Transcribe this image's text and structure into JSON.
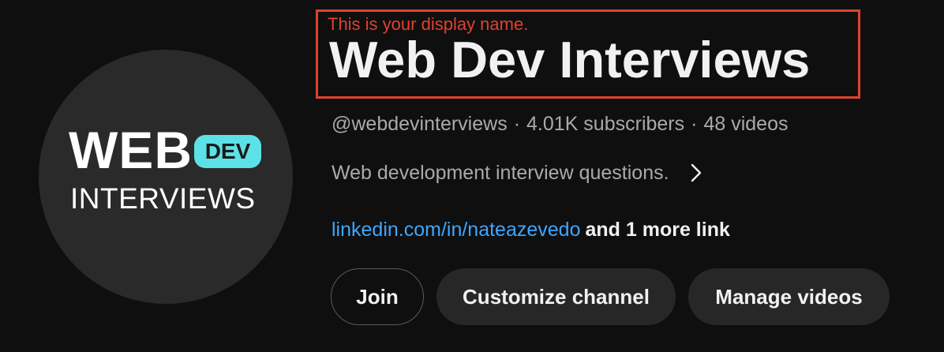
{
  "avatar": {
    "line1": "WEB",
    "badge": "DEV",
    "line2": "INTERVIEWS",
    "badge_color": "#5ce1e6"
  },
  "annotation": {
    "text": "This is your display name.",
    "color": "#e0412f"
  },
  "channel": {
    "name": "Web Dev Interviews",
    "handle": "@webdevinterviews",
    "separator": "·",
    "subscribers": "4.01K subscribers",
    "videos": "48 videos",
    "description": "Web development interview questions.",
    "description_expand_icon": "chevron-right-icon"
  },
  "links": {
    "primary": "linkedin.com/in/nateazevedo",
    "more": "and 1 more link",
    "link_color": "#3ea6ff"
  },
  "buttons": {
    "join": "Join",
    "customize": "Customize channel",
    "manage": "Manage videos"
  }
}
